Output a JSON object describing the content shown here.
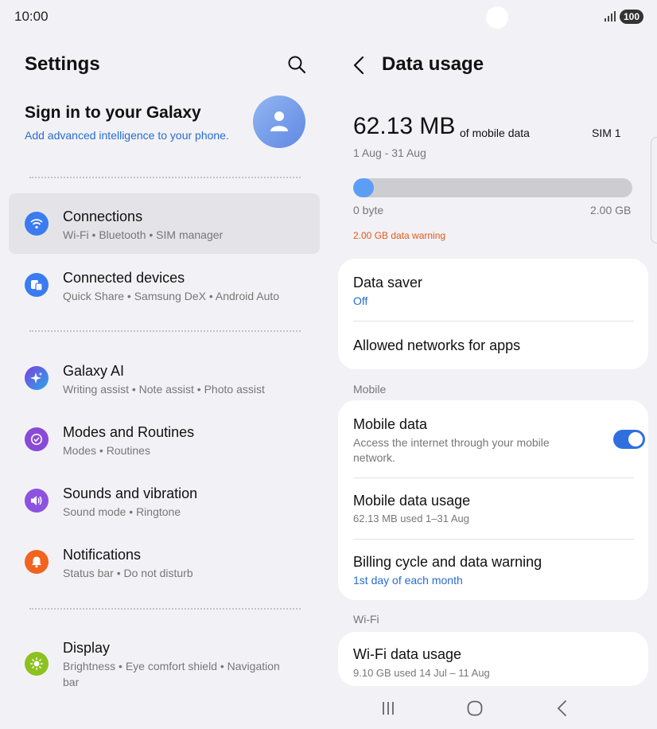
{
  "status_bar": {
    "time": "10:00",
    "battery": "100"
  },
  "left": {
    "title": "Settings",
    "account": {
      "title": "Sign in to your Galaxy",
      "subtitle": "Add advanced intelligence to your phone."
    },
    "items": [
      {
        "title": "Connections",
        "subtitle": "Wi-Fi  •  Bluetooth  •  SIM manager",
        "icon": "wifi-icon",
        "color": "#3b7bf0"
      },
      {
        "title": "Connected devices",
        "subtitle": "Quick Share  •  Samsung DeX  •  Android Auto",
        "icon": "connected-devices-icon",
        "color": "#3b7bf0"
      },
      {
        "title": "Galaxy AI",
        "subtitle": "Writing assist  •  Note assist  •  Photo assist",
        "icon": "galaxy-ai-icon",
        "color": "#4a56d8"
      },
      {
        "title": "Modes and Routines",
        "subtitle": "Modes  •  Routines",
        "icon": "modes-icon",
        "color": "#8a4ad8"
      },
      {
        "title": "Sounds and vibration",
        "subtitle": "Sound mode  •  Ringtone",
        "icon": "volume-icon",
        "color": "#8d52e0"
      },
      {
        "title": "Notifications",
        "subtitle": "Status bar  •  Do not disturb",
        "icon": "bell-icon",
        "color": "#f0641e"
      },
      {
        "title": "Display",
        "subtitle": "Brightness  •  Eye comfort shield  •  Navigation",
        "subtitle2": "bar",
        "icon": "sun-icon",
        "color": "#8cc21f"
      }
    ]
  },
  "right": {
    "title": "Data usage",
    "usage": {
      "amount": "62.13 MB",
      "unit": "of mobile data",
      "sim": "SIM 1",
      "range": "1 Aug - 31 Aug",
      "bar_min": "0 byte",
      "bar_max": "2.00 GB",
      "fraction": 0.0303,
      "warning": "2.00 GB data warning"
    },
    "card1": {
      "data_saver": {
        "title": "Data saver",
        "value": "Off"
      },
      "allowed_networks": {
        "title": "Allowed networks for apps"
      }
    },
    "mobile_header": "Mobile",
    "card2": {
      "mobile_data": {
        "title": "Mobile data",
        "desc1": "Access the internet through your mobile",
        "desc2": "network.",
        "enabled": true
      },
      "mobile_data_usage": {
        "title": "Mobile data usage",
        "sub": "62.13 MB used 1–31 Aug"
      },
      "billing": {
        "title": "Billing cycle and data warning",
        "sub": "1st day of each month"
      }
    },
    "wifi_header": "Wi-Fi",
    "card3": {
      "wifi_usage": {
        "title": "Wi-Fi data usage",
        "sub": "9.10 GB used 14 Jul – 11 Aug"
      }
    }
  },
  "colors": {
    "accent": "#2a6bd1",
    "warning": "#e5581a",
    "toggle_on": "#2f6fe0",
    "bar_fill": "#5d9ef5"
  }
}
